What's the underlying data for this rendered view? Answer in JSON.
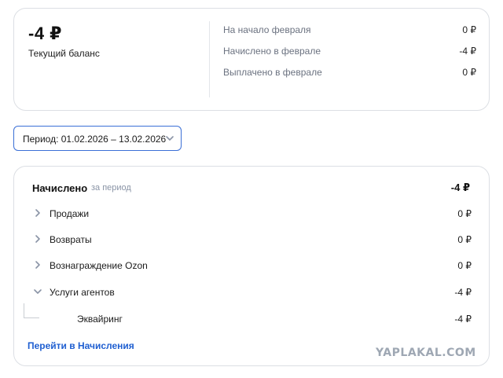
{
  "balance": {
    "amount": "-4 ₽",
    "label": "Текущий баланс",
    "stats": [
      {
        "label": "На начало февраля",
        "value": "0 ₽"
      },
      {
        "label": "Начислено в феврале",
        "value": "-4 ₽"
      },
      {
        "label": "Выплачено в феврале",
        "value": "0 ₽"
      }
    ]
  },
  "period": {
    "text": "Период: 01.02.2026 – 13.02.2026"
  },
  "accruals": {
    "title": "Начислено",
    "subtitle": "за период",
    "total": "-4 ₽",
    "rows": [
      {
        "label": "Продажи",
        "value": "0 ₽",
        "icon": "chevron-right-icon"
      },
      {
        "label": "Возвраты",
        "value": "0 ₽",
        "icon": "chevron-right-icon"
      },
      {
        "label": "Вознаграждение Ozon",
        "value": "0 ₽",
        "icon": "chevron-right-icon"
      },
      {
        "label": "Услуги агентов",
        "value": "-4 ₽",
        "icon": "chevron-down-icon"
      }
    ],
    "subrows": [
      {
        "label": "Эквайринг",
        "value": "-4 ₽"
      }
    ],
    "link": "Перейти в Начисления"
  },
  "watermark": "YAPLAKAL.COM",
  "colors": {
    "accent": "#3b6fd6",
    "link": "#1f5fd1",
    "muted": "#6b7280",
    "border": "#dcdfe4"
  }
}
